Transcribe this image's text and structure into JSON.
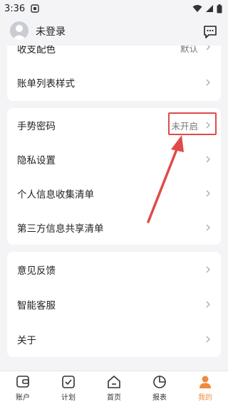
{
  "status": {
    "time": "3:36"
  },
  "header": {
    "username": "未登录"
  },
  "settings_top": {
    "partial_label": "收支配色",
    "partial_value": "默认",
    "bill_style_label": "账单列表样式"
  },
  "security": {
    "gesture_label": "手势密码",
    "gesture_value": "未开启",
    "privacy_label": "隐私设置",
    "personal_info_label": "个人信息收集清单",
    "third_party_label": "第三方信息共享清单"
  },
  "support": {
    "feedback_label": "意见反馈",
    "service_label": "智能客服",
    "about_label": "关于"
  },
  "tabs": [
    {
      "label": "账户",
      "icon": "wallet-icon"
    },
    {
      "label": "计划",
      "icon": "checklist-icon"
    },
    {
      "label": "首页",
      "icon": "home-icon"
    },
    {
      "label": "报表",
      "icon": "pie-icon"
    },
    {
      "label": "我的",
      "icon": "person-icon"
    }
  ],
  "colors": {
    "accent": "#f08a3c",
    "annotation": "#e04a4a"
  }
}
